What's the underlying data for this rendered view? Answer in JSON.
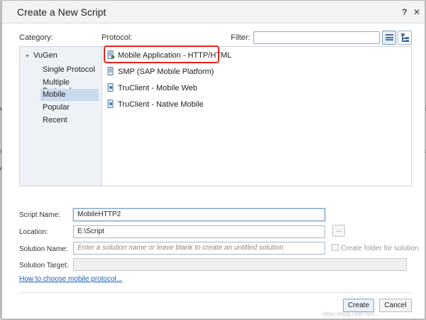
{
  "background": {
    "fragments": [
      "e",
      "ti",
      "s",
      "e",
      "s"
    ]
  },
  "dialog": {
    "title": "Create a New Script",
    "help_label": "?",
    "close_label": "✕"
  },
  "labels": {
    "category": "Category:",
    "protocol": "Protocol:",
    "filter": "Filter:"
  },
  "filter": {
    "value": ""
  },
  "categories": {
    "root": "VuGen",
    "items": [
      "Single Protocol",
      "Multiple Protocols",
      "Mobile",
      "Popular",
      "Recent"
    ],
    "selected": "Mobile"
  },
  "protocols": {
    "items": [
      "Mobile Application - HTTP/HTML",
      "SMP (SAP Mobile Platform)",
      "TruClient - Mobile Web",
      "TruClient - Native Mobile"
    ],
    "highlighted": "Mobile Application - HTTP/HTML"
  },
  "form": {
    "script_name_label": "Script Name:",
    "script_name_value": "MobileHTTP2",
    "location_label": "Location:",
    "location_value": "E:\\Script",
    "browse_label": "...",
    "solution_name_label": "Solution Name:",
    "solution_name_placeholder": "Enter a solution name or leave blank to create an untitled solution",
    "create_folder_label": "Create folder for solution",
    "solution_target_label": "Solution Target:",
    "solution_target_value": ""
  },
  "help_link": "How to choose mobile protocol...",
  "buttons": {
    "create": "Create",
    "cancel": "Cancel"
  },
  "watermark": "https://blog.csdn.net/...",
  "colors": {
    "highlight": "#e3251d",
    "selection": "#c9d9ee",
    "link": "#1a5fb4"
  }
}
